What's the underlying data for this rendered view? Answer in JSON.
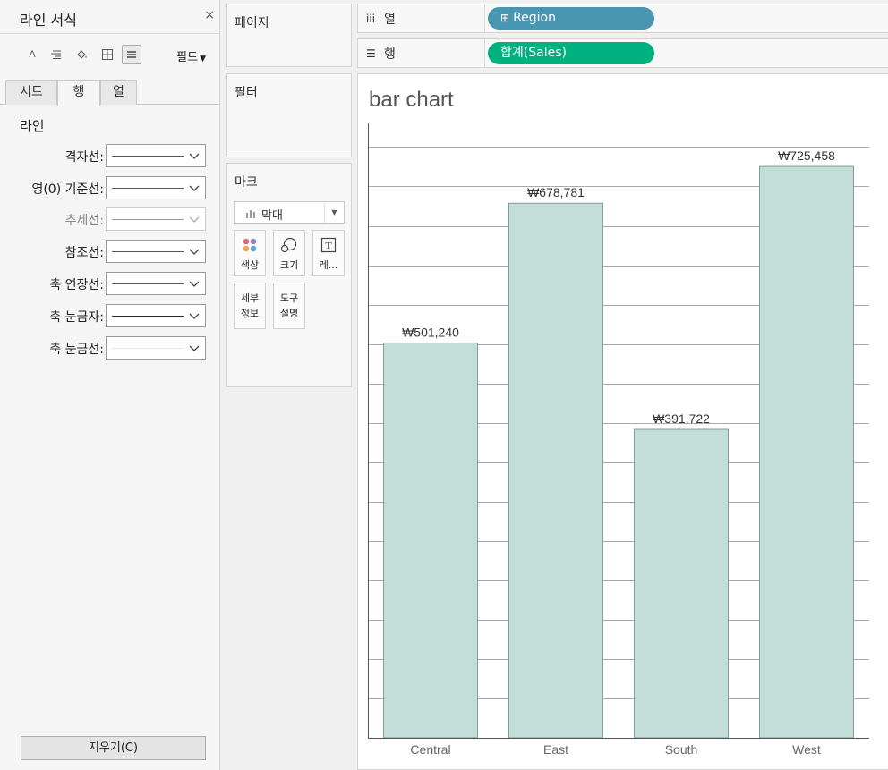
{
  "format_panel": {
    "title": "라인 서식",
    "close": "×",
    "fields_label": "필드",
    "toolbar": [
      "font-icon",
      "align-icon",
      "shading-icon",
      "borders-icon",
      "lines-icon"
    ],
    "tabs": [
      "시트",
      "행",
      "열"
    ],
    "active_tab": "행",
    "section": "라인",
    "rows": [
      {
        "label": "격자선:",
        "style": "solid",
        "enabled": true
      },
      {
        "label": "영(0) 기준선:",
        "style": "solid",
        "enabled": true
      },
      {
        "label": "추세선:",
        "style": "solid",
        "enabled": false
      },
      {
        "label": "참조선:",
        "style": "solid",
        "enabled": true
      },
      {
        "label": "축 연장선:",
        "style": "solid",
        "enabled": true
      },
      {
        "label": "축 눈금자:",
        "style": "solid-dark",
        "enabled": true
      },
      {
        "label": "축 눈금선:",
        "style": "none",
        "enabled": true
      }
    ],
    "clear_button": "지우기(C)"
  },
  "cards": {
    "pages": "페이지",
    "filters": "필터",
    "marks": {
      "title": "마크",
      "type": "막대",
      "buttons": [
        {
          "label": "색상",
          "icon": "color-dots-icon"
        },
        {
          "label": "크기",
          "icon": "size-circles-icon"
        },
        {
          "label": "레...",
          "icon": "text-label-icon"
        },
        {
          "label": "세부\n정보",
          "icon": ""
        },
        {
          "label": "도구\n설명",
          "icon": ""
        }
      ]
    }
  },
  "shelves": {
    "columns": {
      "icon": "iii",
      "label": "열",
      "pill": "Region",
      "pill_prefix": "⊞",
      "pill_color": "#4996b2"
    },
    "rows": {
      "icon": "☰",
      "label": "행",
      "pill": "합계(Sales)",
      "pill_color": "#00b180"
    }
  },
  "chart_data": {
    "type": "bar",
    "title": "bar chart",
    "categories": [
      "Central",
      "East",
      "South",
      "West"
    ],
    "values": [
      501240,
      678781,
      391722,
      725458
    ],
    "value_labels": [
      "₩501,240",
      "₩678,781",
      "₩391,722",
      "₩725,458"
    ],
    "ylim": [
      0,
      780000
    ],
    "ygrid_step": 50000,
    "ytick_labels_shown": false,
    "bar_color": "#c3ddd9",
    "bar_stroke": "#6e8985",
    "grid": true
  }
}
